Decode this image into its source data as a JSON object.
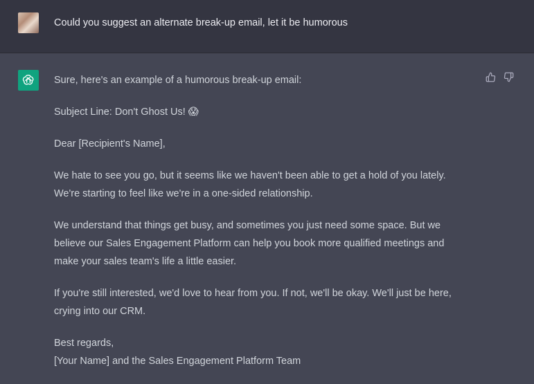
{
  "user": {
    "prompt": "Could you suggest an alternate break-up email, let it be humorous"
  },
  "assistant": {
    "intro": "Sure, here's an example of a humorous break-up email:",
    "subject": "Subject Line: Don't Ghost Us! 😱",
    "greeting": "Dear [Recipient's Name],",
    "para1_line1": "We hate to see you go, but it seems like we haven't been able to get a hold of you lately.",
    "para1_line2": "We're starting to feel like we're in a one-sided relationship.",
    "para2_line1": "We understand that things get busy, and sometimes you just need some space. But we",
    "para2_line2": "believe our Sales Engagement Platform can help you book more qualified meetings and",
    "para2_line3": "make your sales team's life a little easier.",
    "para3_line1": "If you're still interested, we'd love to hear from you. If not, we'll be okay. We'll just be here,",
    "para3_line2": "crying into our CRM.",
    "signoff_line1": "Best regards,",
    "signoff_line2": "[Your Name] and the Sales Engagement Platform Team"
  },
  "icons": {
    "user_avatar": "user-avatar",
    "assistant_avatar": "openai-logo-icon",
    "thumbs_up": "thumbs-up-icon",
    "thumbs_down": "thumbs-down-icon"
  },
  "colors": {
    "user_bg": "#343541",
    "assistant_bg": "#444654",
    "brand": "#10a37f",
    "text": "#d1d5db"
  }
}
